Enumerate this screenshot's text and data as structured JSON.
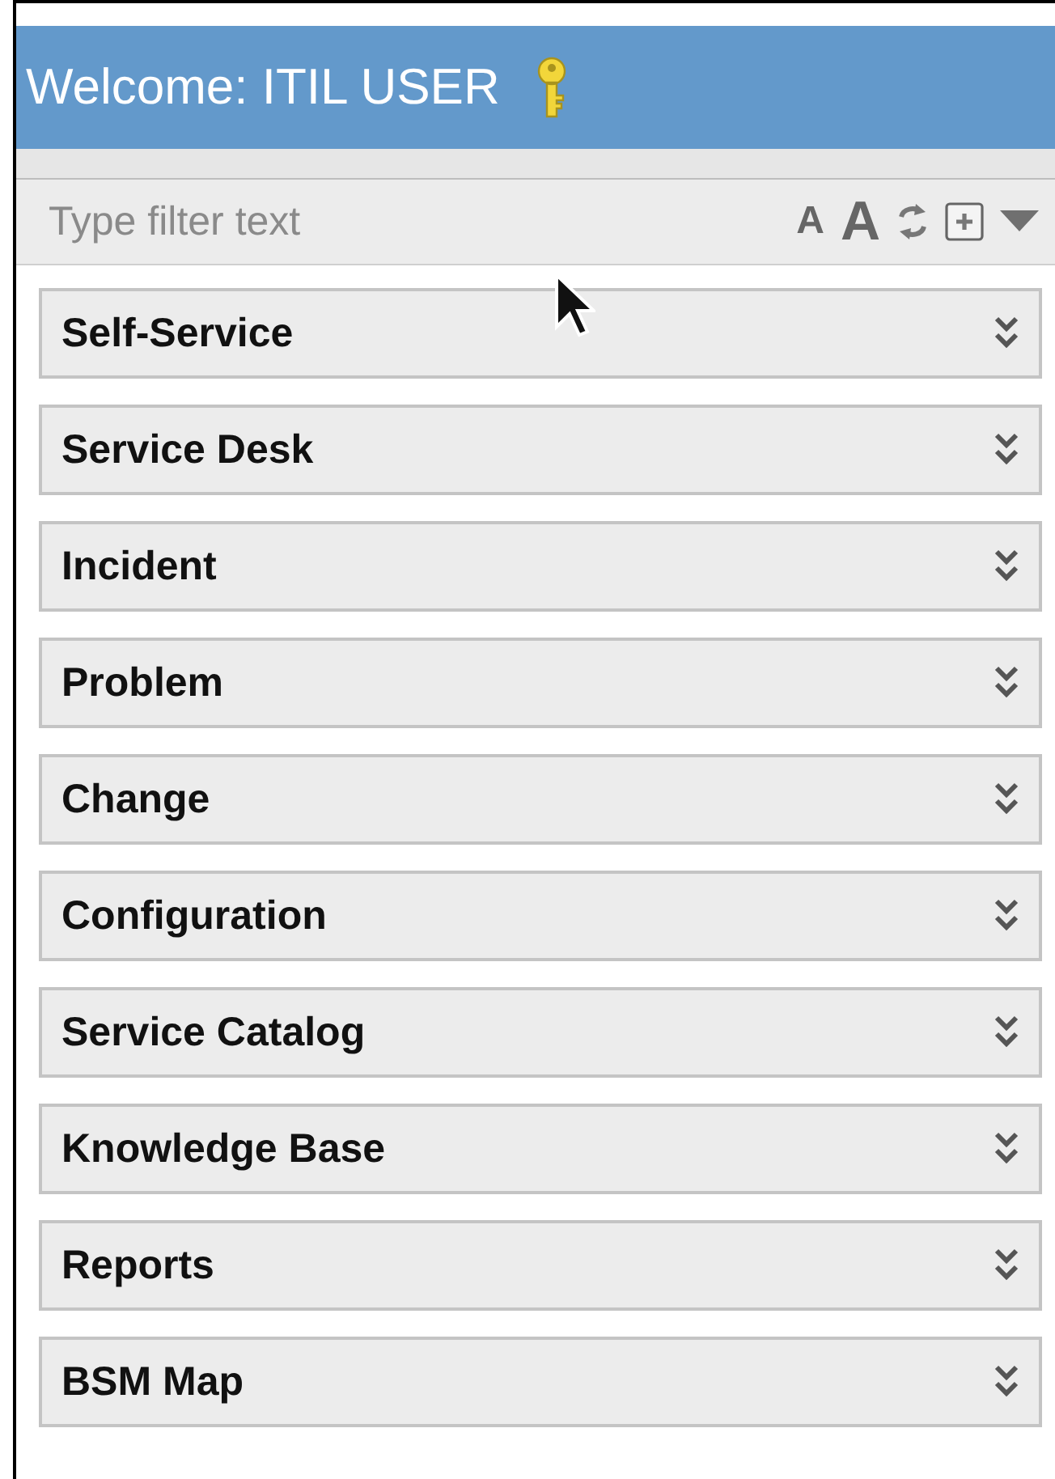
{
  "header": {
    "title": "Welcome: ITIL USER"
  },
  "filter": {
    "placeholder": "Type filter text",
    "font_buttons": [
      "A",
      "A"
    ]
  },
  "sections": [
    {
      "label": "Self-Service",
      "expanded": false
    },
    {
      "label": "Service Desk",
      "expanded": false
    },
    {
      "label": "Incident",
      "expanded": false
    },
    {
      "label": "Problem",
      "expanded": false
    },
    {
      "label": "Change",
      "expanded": false
    },
    {
      "label": "Configuration",
      "expanded": false
    },
    {
      "label": "Service Catalog",
      "expanded": false
    },
    {
      "label": "Knowledge Base",
      "expanded": false
    },
    {
      "label": "Reports",
      "expanded": false
    },
    {
      "label": "BSM Map",
      "expanded": false
    }
  ]
}
